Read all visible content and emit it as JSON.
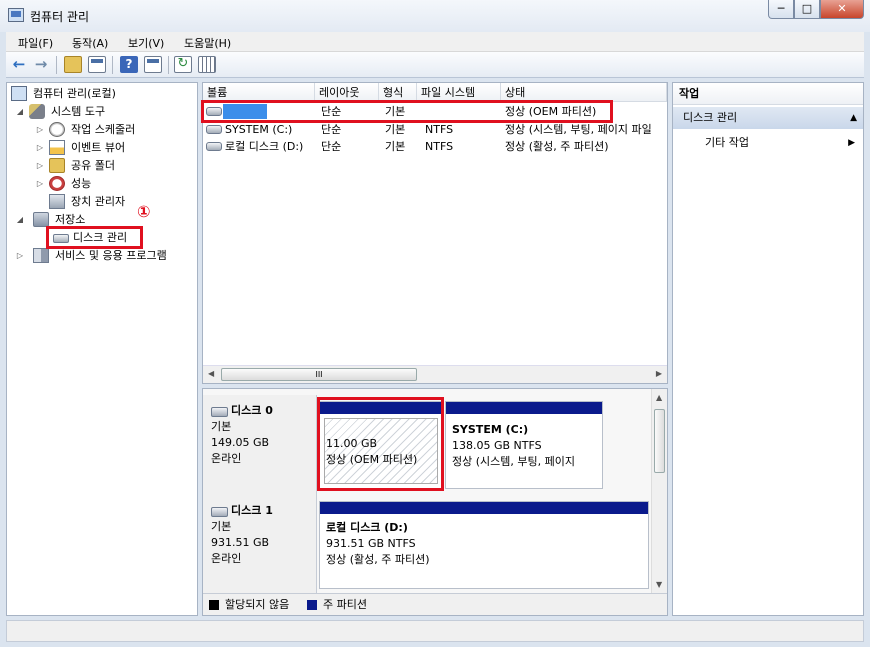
{
  "window": {
    "title": "컴퓨터 관리"
  },
  "menu": [
    "파일(F)",
    "동작(A)",
    "보기(V)",
    "도움말(H)"
  ],
  "tree": {
    "root": "컴퓨터 관리(로컬)",
    "system_tools": "시스템 도구",
    "task_scheduler": "작업 스케줄러",
    "event_viewer": "이벤트 뷰어",
    "shared_folders": "공유 폴더",
    "performance": "성능",
    "device_manager": "장치 관리자",
    "storage": "저장소",
    "disk_management": "디스크 관리",
    "services": "서비스 및 응용 프로그램"
  },
  "annotation": {
    "number": "①"
  },
  "volume_list": {
    "columns": [
      "볼륨",
      "레이아웃",
      "형식",
      "파일 시스템",
      "상태"
    ],
    "rows": [
      {
        "volume": "",
        "layout": "단순",
        "type": "기본",
        "fs": "",
        "status": "정상 (OEM 파티션)"
      },
      {
        "volume": "SYSTEM (C:)",
        "layout": "단순",
        "type": "기본",
        "fs": "NTFS",
        "status": "정상 (시스템, 부팅, 페이지 파일"
      },
      {
        "volume": "로컬 디스크 (D:)",
        "layout": "단순",
        "type": "기본",
        "fs": "NTFS",
        "status": "정상 (활성, 주 파티션)"
      }
    ],
    "scroll_thumb": "III"
  },
  "disks": [
    {
      "name": "디스크 0",
      "type": "기본",
      "size": "149.05 GB",
      "state": "온라인",
      "partitions": [
        {
          "title": "",
          "size": "11.00 GB",
          "status": "정상 (OEM 파티션)"
        },
        {
          "title": "SYSTEM  (C:)",
          "size": "138.05 GB NTFS",
          "status": "정상 (시스템, 부팅, 페이지"
        }
      ]
    },
    {
      "name": "디스크 1",
      "type": "기본",
      "size": "931.51 GB",
      "state": "온라인",
      "partitions": [
        {
          "title": "로컬 디스크  (D:)",
          "size": "931.51 GB NTFS",
          "status": "정상 (활성, 주 파티션)"
        }
      ]
    }
  ],
  "legend": {
    "unallocated": "할당되지 않음",
    "primary": "주 파티션"
  },
  "actions": {
    "title": "작업",
    "section": "디스크 관리",
    "more": "기타 작업"
  },
  "colors": {
    "primary_partition": "#0a1a8c",
    "unallocated": "#000000",
    "highlight": "#e0101f"
  }
}
